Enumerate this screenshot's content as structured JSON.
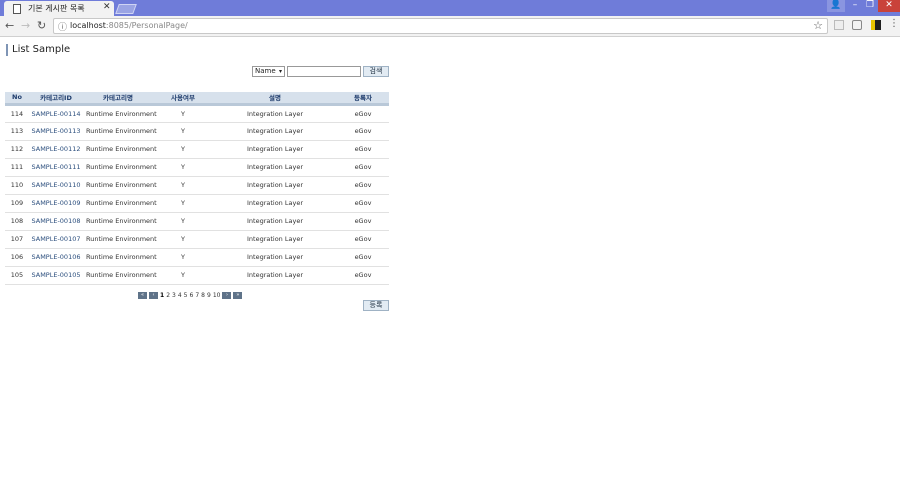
{
  "browser": {
    "tab_title": "기본 게시판 목록",
    "tab_close": "✕",
    "url_host": "localhost",
    "url_rest": ":8085/PersonalPage/",
    "window_buttons": {
      "user": "👤",
      "minimize": "–",
      "maximize": "❐",
      "close": "✕"
    },
    "nav": {
      "back": "←",
      "forward": "→",
      "reload": "↻",
      "info": "ⓘ",
      "star": "☆",
      "menu": "⋮"
    }
  },
  "page": {
    "title": "List Sample",
    "search": {
      "select_value": "Name",
      "select_arrow": "▾",
      "input_value": "",
      "button_label": "검색"
    },
    "table": {
      "headers": [
        "No",
        "카테고리ID",
        "카테고리명",
        "사용여부",
        "설명",
        "등록자"
      ],
      "rows": [
        [
          "114",
          "SAMPLE-00114",
          "Runtime Environment",
          "Y",
          "Integration Layer",
          "eGov"
        ],
        [
          "113",
          "SAMPLE-00113",
          "Runtime Environment",
          "Y",
          "Integration Layer",
          "eGov"
        ],
        [
          "112",
          "SAMPLE-00112",
          "Runtime Environment",
          "Y",
          "Integration Layer",
          "eGov"
        ],
        [
          "111",
          "SAMPLE-00111",
          "Runtime Environment",
          "Y",
          "Integration Layer",
          "eGov"
        ],
        [
          "110",
          "SAMPLE-00110",
          "Runtime Environment",
          "Y",
          "Integration Layer",
          "eGov"
        ],
        [
          "109",
          "SAMPLE-00109",
          "Runtime Environment",
          "Y",
          "Integration Layer",
          "eGov"
        ],
        [
          "108",
          "SAMPLE-00108",
          "Runtime Environment",
          "Y",
          "Integration Layer",
          "eGov"
        ],
        [
          "107",
          "SAMPLE-00107",
          "Runtime Environment",
          "Y",
          "Integration Layer",
          "eGov"
        ],
        [
          "106",
          "SAMPLE-00106",
          "Runtime Environment",
          "Y",
          "Integration Layer",
          "eGov"
        ],
        [
          "105",
          "SAMPLE-00105",
          "Runtime Environment",
          "Y",
          "Integration Layer",
          "eGov"
        ]
      ]
    },
    "pagination": {
      "first": "«",
      "prev": "‹",
      "pages": [
        "1",
        "2",
        "3",
        "4",
        "5",
        "6",
        "7",
        "8",
        "9",
        "10"
      ],
      "current": "1",
      "next": "›",
      "last": "»"
    },
    "register_button": "등록"
  }
}
